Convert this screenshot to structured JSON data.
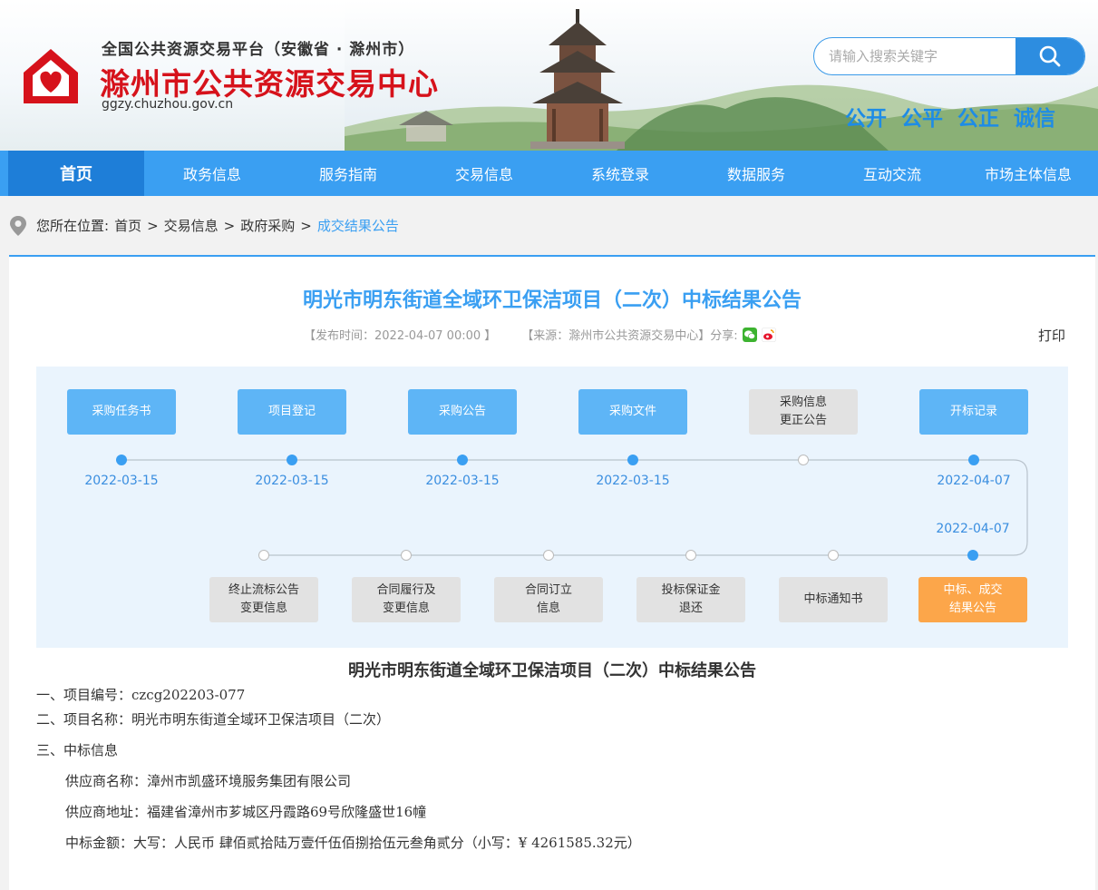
{
  "header": {
    "subtitle": "全国公共资源交易平台（安徽省 · 滁州市）",
    "title": "滁州市公共资源交易中心",
    "domain": "ggzy.chuzhou.gov.cn",
    "search_placeholder": "请输入搜索关键字",
    "slogans": [
      "公开",
      "公平",
      "公正",
      "诚信"
    ],
    "brand_color": "#d6121b",
    "logo_icon": "house-heart-logo-icon"
  },
  "nav": {
    "items": [
      {
        "label": "首页",
        "active": true
      },
      {
        "label": "政务信息"
      },
      {
        "label": "服务指南"
      },
      {
        "label": "交易信息"
      },
      {
        "label": "系统登录"
      },
      {
        "label": "数据服务"
      },
      {
        "label": "互动交流"
      },
      {
        "label": "市场主体信息"
      }
    ],
    "color": "#3a9ff2"
  },
  "breadcrumb": {
    "prefix": "您所在位置:",
    "items": [
      "首页",
      "交易信息",
      "政府采购"
    ],
    "current": "成交结果公告",
    "sep": ">"
  },
  "article": {
    "title": "明光市明东街道全域环卫保洁项目（二次）中标结果公告",
    "publish": "【发布时间：2022-04-07 00:00 】",
    "source": "【来源：滁州市公共资源交易中心】",
    "share_label": "分享:",
    "print_label": "打印"
  },
  "flow": {
    "top": [
      {
        "label": "采购任务书",
        "date": "2022-03-15",
        "state": "done"
      },
      {
        "label": "项目登记",
        "date": "2022-03-15",
        "state": "done"
      },
      {
        "label": "采购公告",
        "date": "2022-03-15",
        "state": "done"
      },
      {
        "label": "采购文件",
        "date": "2022-03-15",
        "state": "done"
      },
      {
        "label": "采购信息\n更正公告",
        "date": "",
        "state": "pending"
      },
      {
        "label": "开标记录",
        "date": "2022-04-07",
        "state": "done"
      }
    ],
    "bottom": [
      {
        "label": "终止流标公告\n变更信息",
        "date": "",
        "state": "pending"
      },
      {
        "label": "合同履行及\n变更信息",
        "date": "",
        "state": "pending"
      },
      {
        "label": "合同订立\n信息",
        "date": "",
        "state": "pending"
      },
      {
        "label": "投标保证金\n退还",
        "date": "",
        "state": "pending"
      },
      {
        "label": "中标通知书",
        "date": "",
        "state": "pending"
      },
      {
        "label": "中标、成交\n结果公告",
        "date": "2022-04-07",
        "state": "current"
      }
    ]
  },
  "doc": {
    "title": "明光市明东街道全域环卫保洁项目（二次）中标结果公告",
    "lines": [
      "一、项目编号：czcg202203-077",
      "二、项目名称：明光市明东街道全域环卫保洁项目（二次）",
      "三、中标信息",
      "供应商名称：漳州市凯盛环境服务集团有限公司",
      "供应商地址：福建省漳州市芗城区丹霞路69号欣隆盛世16幢",
      "中标金额：大写：人民币 肆佰贰拾陆万壹仟伍佰捌拾伍元叁角贰分（小写：¥  4261585.32元）"
    ]
  }
}
